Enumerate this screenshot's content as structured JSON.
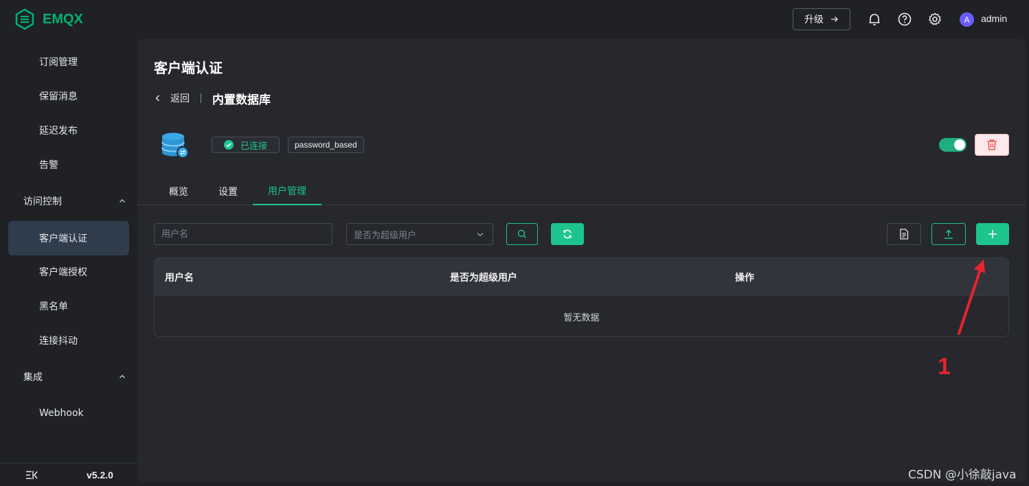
{
  "header": {
    "logo_text": "EMQX",
    "upgrade_label": "升级",
    "avatar_letter": "A",
    "user_name": "admin"
  },
  "sidebar": {
    "items_top": [
      {
        "label": "订阅管理"
      },
      {
        "label": "保留消息"
      },
      {
        "label": "延迟发布"
      },
      {
        "label": "告警"
      }
    ],
    "group_access": "访问控制",
    "items_access": [
      {
        "label": "客户端认证",
        "active": true
      },
      {
        "label": "客户端授权"
      },
      {
        "label": "黑名单"
      },
      {
        "label": "连接抖动"
      }
    ],
    "group_integration": "集成",
    "items_integration": [
      {
        "label": "Webhook"
      }
    ],
    "version": "v5.2.0"
  },
  "main": {
    "title": "客户端认证",
    "back_label": "返回",
    "sub_title": "内置数据库",
    "status": "已连接",
    "mechanism": "password_based",
    "enabled": true,
    "tabs": [
      {
        "label": "概览"
      },
      {
        "label": "设置"
      },
      {
        "label": "用户管理",
        "active": true
      }
    ],
    "filters": {
      "username_placeholder": "用户名",
      "superuser_placeholder": "是否为超级用户"
    },
    "table": {
      "columns": [
        "用户名",
        "是否为超级用户",
        "操作"
      ],
      "empty_text": "暂无数据"
    }
  },
  "colors": {
    "accent": "#1ec48e",
    "danger": "#e8242b",
    "background": "#1f2125",
    "panel": "#26282d"
  },
  "annotation": {
    "number": "1"
  },
  "watermark": "CSDN @小徐敲java"
}
